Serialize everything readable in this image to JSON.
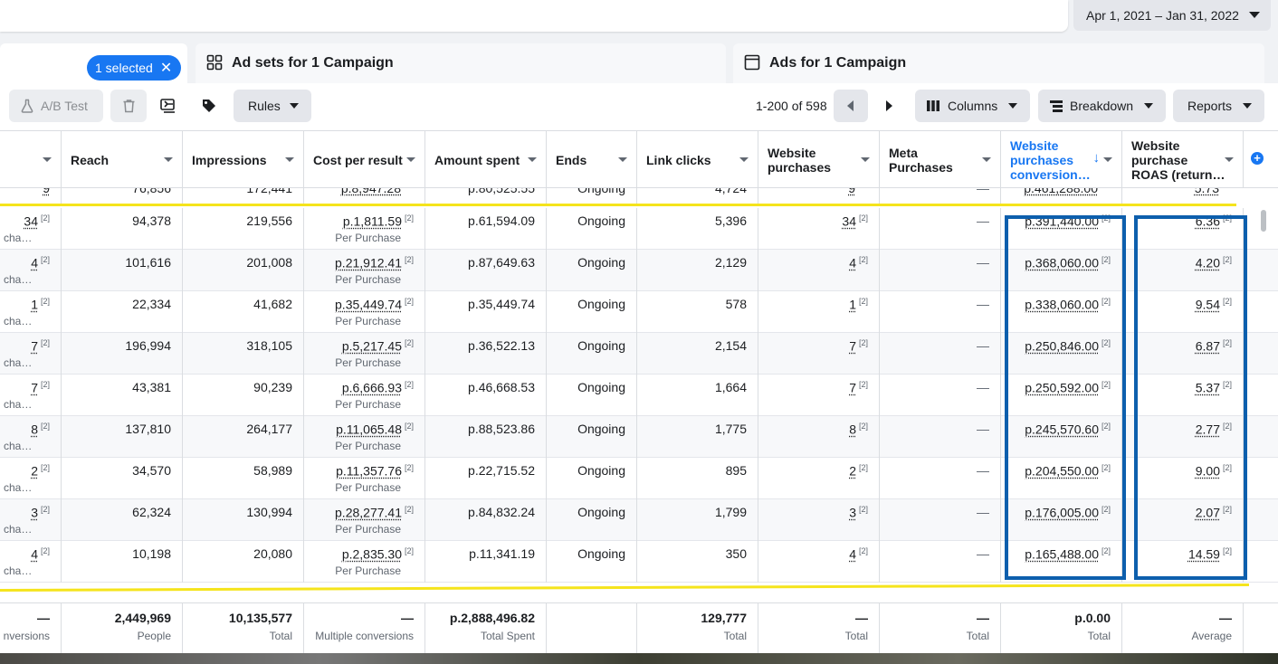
{
  "top": {
    "date_range": "Apr 1, 2021 – Jan 31, 2022"
  },
  "tabs": {
    "selected_label": "1 selected",
    "adsets_label": "Ad sets for 1 Campaign",
    "ads_label": "Ads for 1 Campaign"
  },
  "toolbar": {
    "ab_test": "A/B Test",
    "rules": "Rules",
    "pager": "1-200 of 598",
    "columns": "Columns",
    "breakdown": "Breakdown",
    "reports": "Reports"
  },
  "columns": {
    "reach": "Reach",
    "impressions": "Impressions",
    "cost_per_result": "Cost per result",
    "amount_spent": "Amount spent",
    "ends": "Ends",
    "link_clicks": "Link clicks",
    "website_purchases_1": "Website",
    "website_purchases_2": "purchases",
    "meta_purchases_1": "Meta",
    "meta_purchases_2": "Purchases",
    "wpcv_1": "Website",
    "wpcv_2": "purchases",
    "wpcv_3": "conversion…",
    "roas_1": "Website",
    "roas_2": "purchase",
    "roas_3": "ROAS (return…"
  },
  "labels": {
    "sup": "[2]",
    "per_purchase": "Per Purchase",
    "cha": "cha…",
    "dash": "—"
  },
  "partial_top": {
    "results": "9",
    "reach": "76,856",
    "impressions": "172,441",
    "cost": "p.8,947.28",
    "spent": "p.80,525.55",
    "ends": "Ongoing",
    "clicks": "4,724",
    "purch": "9",
    "conv": "p.461,288.00",
    "roas": "5.73"
  },
  "rows": [
    {
      "results": "34",
      "reach": "94,378",
      "impressions": "219,556",
      "cost": "p.1,811.59",
      "spent": "p.61,594.09",
      "ends": "Ongoing",
      "clicks": "5,396",
      "purch": "34",
      "meta": "—",
      "conv": "p.391,440.00",
      "roas": "6.36"
    },
    {
      "results": "4",
      "reach": "101,616",
      "impressions": "201,008",
      "cost": "p.21,912.41",
      "spent": "p.87,649.63",
      "ends": "Ongoing",
      "clicks": "2,129",
      "purch": "4",
      "meta": "—",
      "conv": "p.368,060.00",
      "roas": "4.20"
    },
    {
      "results": "1",
      "reach": "22,334",
      "impressions": "41,682",
      "cost": "p.35,449.74",
      "spent": "p.35,449.74",
      "ends": "Ongoing",
      "clicks": "578",
      "purch": "1",
      "meta": "—",
      "conv": "p.338,060.00",
      "roas": "9.54"
    },
    {
      "results": "7",
      "reach": "196,994",
      "impressions": "318,105",
      "cost": "p.5,217.45",
      "spent": "p.36,522.13",
      "ends": "Ongoing",
      "clicks": "2,154",
      "purch": "7",
      "meta": "—",
      "conv": "p.250,846.00",
      "roas": "6.87"
    },
    {
      "results": "7",
      "reach": "43,381",
      "impressions": "90,239",
      "cost": "p.6,666.93",
      "spent": "p.46,668.53",
      "ends": "Ongoing",
      "clicks": "1,664",
      "purch": "7",
      "meta": "—",
      "conv": "p.250,592.00",
      "roas": "5.37"
    },
    {
      "results": "8",
      "reach": "137,810",
      "impressions": "264,177",
      "cost": "p.11,065.48",
      "spent": "p.88,523.86",
      "ends": "Ongoing",
      "clicks": "1,775",
      "purch": "8",
      "meta": "—",
      "conv": "p.245,570.60",
      "roas": "2.77"
    },
    {
      "results": "2",
      "reach": "34,570",
      "impressions": "58,989",
      "cost": "p.11,357.76",
      "spent": "p.22,715.52",
      "ends": "Ongoing",
      "clicks": "895",
      "purch": "2",
      "meta": "—",
      "conv": "p.204,550.00",
      "roas": "9.00"
    },
    {
      "results": "3",
      "reach": "62,324",
      "impressions": "130,994",
      "cost": "p.28,277.41",
      "spent": "p.84,832.24",
      "ends": "Ongoing",
      "clicks": "1,799",
      "purch": "3",
      "meta": "—",
      "conv": "p.176,005.00",
      "roas": "2.07"
    },
    {
      "results": "4",
      "reach": "10,198",
      "impressions": "20,080",
      "cost": "p.2,835.30",
      "spent": "p.11,341.19",
      "ends": "Ongoing",
      "clicks": "350",
      "purch": "4",
      "meta": "—",
      "conv": "p.165,488.00",
      "roas": "14.59"
    }
  ],
  "totals": {
    "results": {
      "value": "—",
      "label": "nversions"
    },
    "reach": {
      "value": "2,449,969",
      "label": "People"
    },
    "impressions": {
      "value": "10,135,577",
      "label": "Total"
    },
    "cost": {
      "value": "—",
      "label": "Multiple conversions"
    },
    "spent": {
      "value": "p.2,888,496.82",
      "label": "Total Spent"
    },
    "clicks": {
      "value": "129,777",
      "label": "Total"
    },
    "purch": {
      "value": "—",
      "label": "Total"
    },
    "meta": {
      "value": "—",
      "label": "Total"
    },
    "conv": {
      "value": "p.0.00",
      "label": "Total"
    },
    "roas": {
      "value": "—",
      "label": "Average"
    }
  }
}
